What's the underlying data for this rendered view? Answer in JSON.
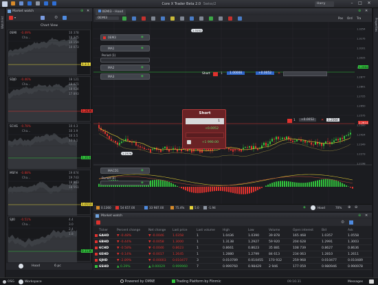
{
  "app": {
    "title": "Core X Trader Beta 2.0",
    "subtitle": "Swiss/2",
    "user": "Harry"
  },
  "colors": {
    "up": "#31c23c",
    "down": "#e0322e",
    "ma_yellow": "#d6c233",
    "accent": "#3a7bd5",
    "panel": "#1c1d21"
  },
  "sidebar_left": {
    "label": "Watchlist"
  },
  "sidebar_right": {
    "label": "Properties"
  },
  "market_watch_panel": {
    "title": "Market watch",
    "subtitle": "Chart View",
    "minis": [
      {
        "name": "0SMI",
        "pct": "-0.49%",
        "desc": "Cha...",
        "nums": [
          "10 378",
          "10 275",
          "10 159",
          "10 073"
        ],
        "badge": "1.3.1.",
        "badge_color": "#e6d43a"
      },
      {
        "name": "SDJ0",
        "pct": "-0.46%",
        "desc": "Cha...",
        "nums": [
          "18 121",
          "18 071",
          "18 024",
          "17 893"
        ],
        "badge": "1.2636",
        "badge_color": "#e0322e"
      },
      {
        "name": "SCHG",
        "pct": "-0.78%",
        "desc": "Cha...",
        "nums": [
          "10 4.3",
          "10 3.9",
          "10 3.5",
          "10 3.1"
        ],
        "badge": "1.313",
        "badge_color": "#31c23c"
      },
      {
        "name": "MSFH",
        "pct": "-0.88%",
        "desc": "Cha...",
        "nums": [
          "19 874",
          "19 743",
          "18 963",
          "18 561"
        ],
        "badge": "1.0110",
        "badge_color": "#e6d43a"
      },
      {
        "name": "SJI0",
        "pct": "-0.51%",
        "desc": "Cha...",
        "nums": [
          "4.4",
          "3.0",
          "2.4",
          "1.8"
        ],
        "badge": "0.1136",
        "badge_color": "#31c23c"
      }
    ],
    "footer": {
      "mode": "Hood",
      "count": "6 pc"
    }
  },
  "chart": {
    "tab_label": "0EMI3 - Hood",
    "symbol": "0EMI3",
    "top_right_buttons": [
      "Pos",
      "Ord",
      "Tra"
    ],
    "indicators": [
      {
        "name": "0EM3"
      },
      {
        "name": "MA1"
      },
      {
        "name": "MA2"
      },
      {
        "name": "MA3"
      }
    ],
    "period_label": "Period (1)",
    "macd_label": "MACD1",
    "macd_period": "Period (4)",
    "pos_line": {
      "side": "Short",
      "qty": "1",
      "price": "1.00000",
      "pl": "+0.0052"
    },
    "order_line": {
      "qty": "1",
      "price": "+0.0052"
    },
    "price_tags": [
      {
        "value": "1.2964",
        "color": "#31c23c"
      },
      {
        "value": "1.2614",
        "color": "#e0322e"
      }
    ],
    "order_ticket": {
      "title": "Short",
      "qty": "1",
      "pl_top": "+0.0052",
      "pl_bottom": "+1 990.00"
    },
    "low_label": "1.2614",
    "bubble_high": "1.3152",
    "bubble_low": "1.2376",
    "bubble_right": "1.2564",
    "y_ticks": [
      "1.3254",
      "1.3175",
      "1.3101",
      "1.3025",
      "1.2952",
      "1.2877",
      "1.2801",
      "1.2725",
      "1.2650",
      "1.2575",
      "1.2500",
      "1.2424",
      "1.2349",
      "1.2273",
      "1.2198"
    ],
    "x_ticks": [
      "Apr",
      "May",
      "Jun",
      "Jul",
      "Aug",
      "Sep",
      "Oct"
    ],
    "status_bar": {
      "bar1": "0.1360",
      "bar2": "54 657.00",
      "bar3": "33 987.00",
      "bar4": "75.4%",
      "bar5": "5.0",
      "bar6": "-1.94",
      "mode": "Hood",
      "zoom": "70%"
    }
  },
  "watch_table": {
    "title": "Market watch",
    "headers": [
      "Ticker",
      "Percent change",
      "Net change",
      "Last price",
      "Last volume",
      "High",
      "Low",
      "Volume",
      "Open interest",
      "Bid",
      "Ask"
    ],
    "rows": [
      {
        "ticker": "6AHD",
        "pct": "-0.48%",
        "net": "-0.0046",
        "last": "1.0358",
        "lvol": "1",
        "high": "1.0436",
        "low": "1.0390",
        "vol": "39 878",
        "oi": "165 468",
        "bid": "1.0357",
        "ask": "1.0558",
        "dir": "down"
      },
      {
        "ticker": "6BHD",
        "pct": "-0.44%",
        "net": "-0.0058",
        "last": "1.3000",
        "lvol": "1",
        "high": "1.3138",
        "low": "1.2927",
        "vol": "59 920",
        "oi": "204 628",
        "bid": "1.2991",
        "ask": "1.3003",
        "dir": "down"
      },
      {
        "ticker": "6CHD",
        "pct": "-0.58%",
        "net": "-0.0046",
        "last": "0.8623",
        "lvol": "1",
        "high": "0.8661",
        "low": "0.8623",
        "vol": "35 881",
        "oi": "108 739",
        "bid": "0.8627",
        "ask": "0.8636",
        "dir": "down"
      },
      {
        "ticker": "6EHD",
        "pct": "-0.14%",
        "net": "-0.0017",
        "last": "1.2645",
        "lvol": "1",
        "high": "1.2880",
        "low": "1.2799",
        "vol": "84 613",
        "oi": "234 063",
        "bid": "1.2810",
        "ask": "1.2611",
        "dir": "down"
      },
      {
        "ticker": "6JHD",
        "pct": "-2.89%",
        "net": "-0.00003",
        "last": "0.010477",
        "lvol": "3",
        "high": "0.010789",
        "low": "0.010455",
        "vol": "170 932",
        "oi": "259 968",
        "bid": "0.010477",
        "ask": "0.010489",
        "dir": "down"
      },
      {
        "ticker": "6SHD",
        "pct": "0.29%",
        "net": "0.00029",
        "last": "0.999960",
        "lvol": "7",
        "high": "0.999760",
        "low": "0.98429",
        "vol": "2 946",
        "oi": "177 059",
        "bid": "0.980946",
        "ask": "0.990978",
        "dir": "up"
      }
    ]
  },
  "bottom_bar": {
    "left1": "OSG",
    "left2": "Hood",
    "left3": "Workspace",
    "center": "Powered by OMNE",
    "center2": "Trading Platform by Fiinmic",
    "time": "09:16:31",
    "messages": "Messages"
  }
}
